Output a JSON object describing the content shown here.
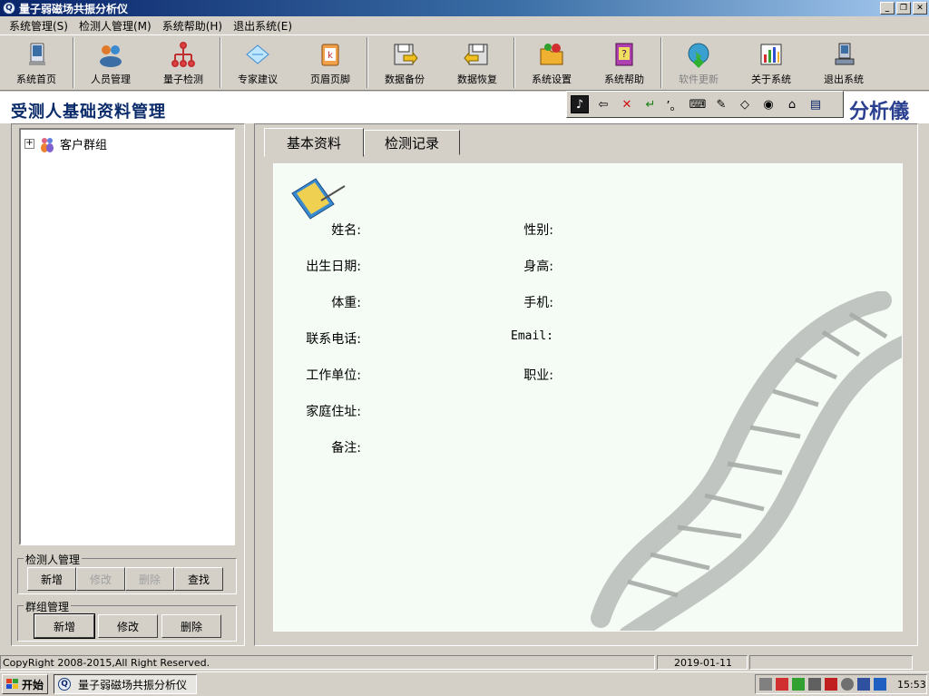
{
  "window": {
    "title": "量子弱磁场共振分析仪",
    "buttons": [
      "_",
      "❐",
      "✕"
    ]
  },
  "menu": [
    "系统管理(S)",
    "检测人管理(M)",
    "系统帮助(H)",
    "退出系统(E)"
  ],
  "toolbar": [
    {
      "label": "系统首页",
      "icon": "monitor-icon"
    },
    {
      "label": "人员管理",
      "icon": "people-icon"
    },
    {
      "label": "量子检测",
      "icon": "network-icon"
    },
    {
      "label": "专家建议",
      "icon": "note-icon"
    },
    {
      "label": "页眉页脚",
      "icon": "clipboard-icon"
    },
    {
      "label": "数据备份",
      "icon": "disk-backup-icon"
    },
    {
      "label": "数据恢复",
      "icon": "disk-restore-icon"
    },
    {
      "label": "系统设置",
      "icon": "folder-settings-icon"
    },
    {
      "label": "系统帮助",
      "icon": "help-book-icon"
    },
    {
      "label": "软件更新",
      "icon": "globe-update-icon",
      "disabled": true
    },
    {
      "label": "关于系统",
      "icon": "chart-icon"
    },
    {
      "label": "退出系统",
      "icon": "computer-exit-icon"
    }
  ],
  "header": {
    "page_title": "受测人基础资料管理",
    "brand_partial": "分析儀"
  },
  "tree": {
    "root_label": "客户群组",
    "expander": "+"
  },
  "tester_group": {
    "legend": "检测人管理",
    "buttons": [
      {
        "label": "新增",
        "disabled": false
      },
      {
        "label": "修改",
        "disabled": true
      },
      {
        "label": "删除",
        "disabled": true
      },
      {
        "label": "查找",
        "disabled": false
      }
    ]
  },
  "group_mgmt": {
    "legend": "群组管理",
    "buttons": [
      {
        "label": "新增"
      },
      {
        "label": "修改"
      },
      {
        "label": "删除"
      }
    ]
  },
  "tabs": [
    {
      "label": "基本资料",
      "active": true
    },
    {
      "label": "检测记录",
      "active": false
    }
  ],
  "form": {
    "left": [
      "姓名:",
      "出生日期:",
      "体重:",
      "联系电话:",
      "工作单位:",
      "家庭住址:",
      "备注:"
    ],
    "right": [
      "性别:",
      "身高:",
      "手机:",
      "Email:",
      "职业:"
    ]
  },
  "status": {
    "copyright": "CopyRight 2008-2015,All Right Reserved.",
    "date": "2019-01-11"
  },
  "taskbar": {
    "start_label": "开始",
    "task_label": "量子弱磁场共振分析仪",
    "clock": "15:53"
  },
  "colors": {
    "titlebar": "#0a246a",
    "page_title": "#0a2a6a",
    "content_bg": "#f5fbf5",
    "chrome": "#d4d0c8"
  }
}
